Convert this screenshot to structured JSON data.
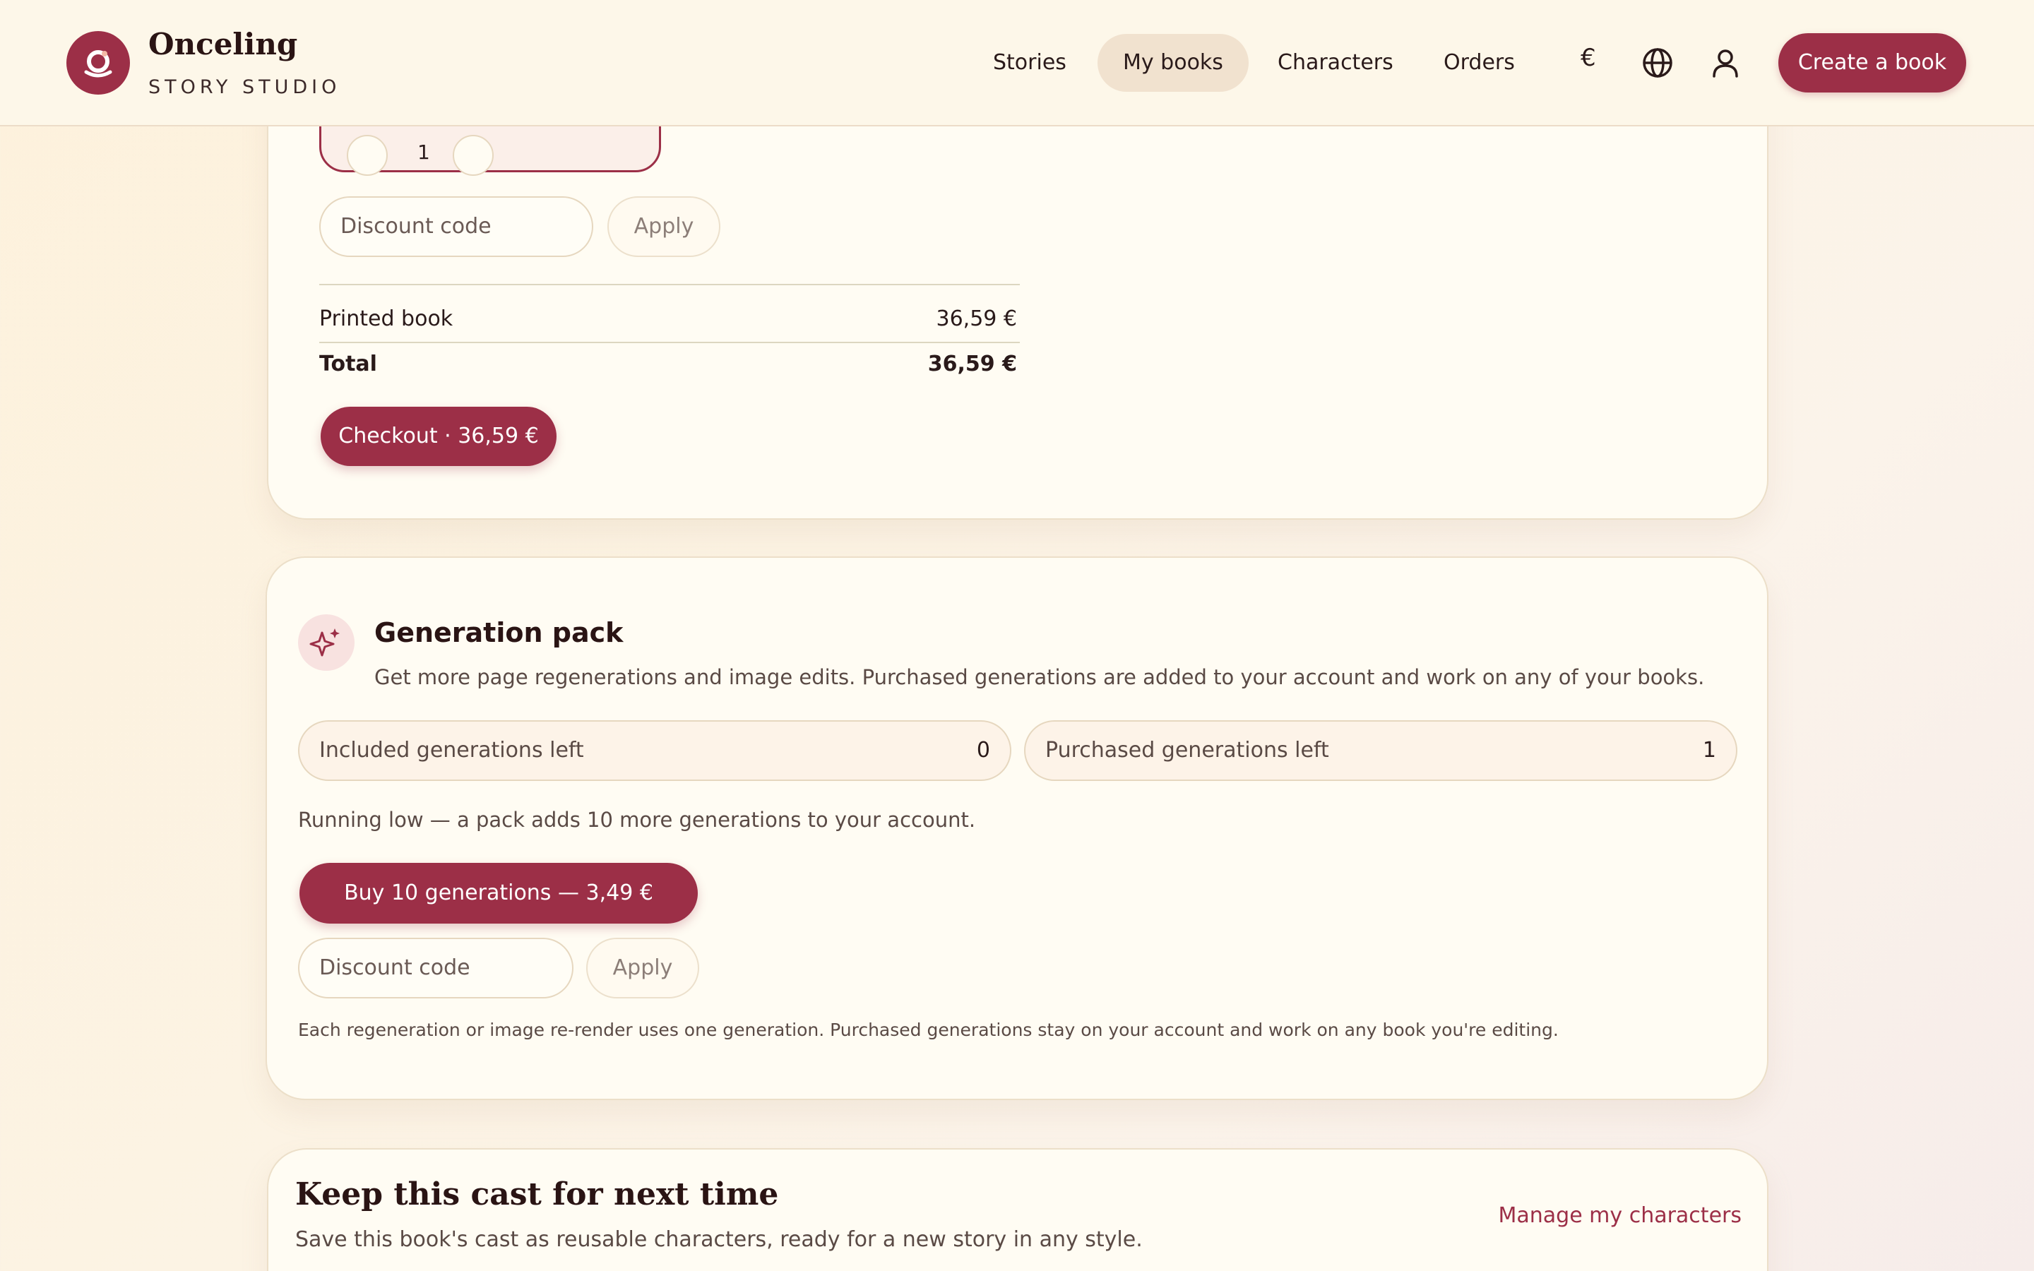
{
  "header": {
    "brand_name": "Onceling",
    "brand_sub": "STORY STUDIO",
    "nav": [
      "Stories",
      "My books",
      "Characters",
      "Orders"
    ],
    "active_nav": "My books",
    "currency_symbol": "€",
    "create_label": "Create a book"
  },
  "order_card": {
    "quantity": "1",
    "discount_placeholder": "Discount code",
    "apply_label": "Apply",
    "line_item_label": "Printed book",
    "line_item_value": "36,59 €",
    "total_label": "Total",
    "total_value": "36,59 €",
    "checkout_label": "Checkout · 36,59 €"
  },
  "generation_card": {
    "title": "Generation pack",
    "description": "Get more page regenerations and image edits. Purchased generations are added to your account and work on any of your books.",
    "included_label": "Included generations left",
    "included_value": "0",
    "purchased_label": "Purchased generations left",
    "purchased_value": "1",
    "notice": "Running low — a pack adds 10 more generations to your account.",
    "buy_label": "Buy 10 generations — 3,49 €",
    "discount_placeholder": "Discount code",
    "apply_label": "Apply",
    "footnote": "Each regeneration or image re-render uses one generation. Purchased generations stay on your account and work on any book you're editing."
  },
  "cast_card": {
    "title": "Keep this cast for next time",
    "description": "Save this book's cast as reusable characters, ready for a new story in any style.",
    "manage_link": "Manage my characters"
  },
  "colors": {
    "accent": "#9c2f47",
    "background": "#fdf7e9",
    "card": "#fffcf3"
  }
}
